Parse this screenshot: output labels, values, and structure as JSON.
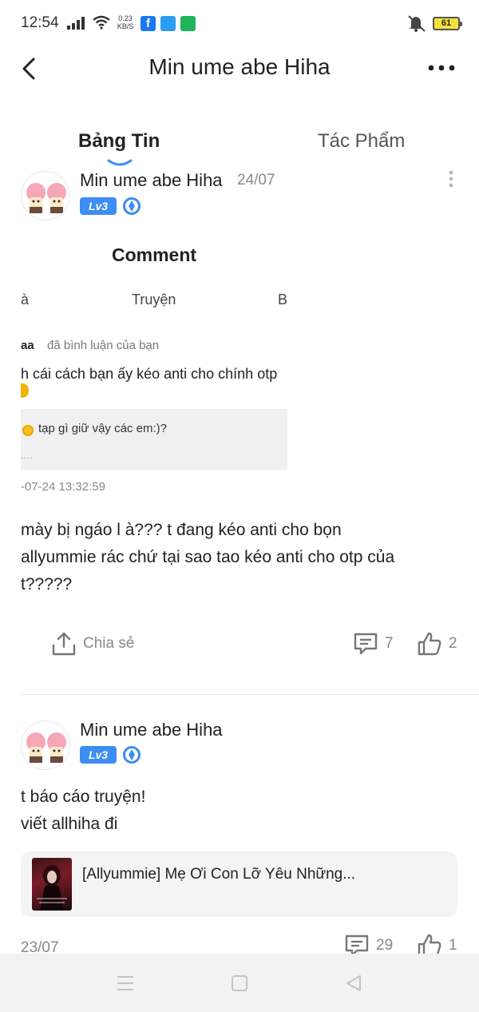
{
  "status_bar": {
    "time": "12:54",
    "net_speed_value": "0.23",
    "net_speed_unit": "KB/S",
    "battery": "61",
    "icons": [
      "signal-icon",
      "wifi-icon",
      "facebook-icon",
      "messenger-icon",
      "app-icon",
      "mute-icon",
      "battery-icon"
    ]
  },
  "header": {
    "title": "Min ume abe Hiha"
  },
  "tabs": [
    {
      "label": "Bảng Tin",
      "active": true
    },
    {
      "label": "Tác Phẩm",
      "active": false
    }
  ],
  "posts": [
    {
      "author": "Min ume abe Hiha",
      "date": "24/07",
      "level": "Lv3",
      "embedded": {
        "heading": "Comment",
        "tab_left": "à",
        "tab_mid": "Truyện",
        "tab_right": "B",
        "notif_user": "aa",
        "notif_action": "đã bình luận của bạn",
        "comment_text": "h cái cách bạn ấy kéo anti cho chính otp",
        "quote_text": "tạp gì giữ vậy các em:)?",
        "quote_more": "....",
        "timestamp": "-07-24 13:32:59"
      },
      "body_lines": [
        "mày bị ngáo l à??? t đang kéo anti cho bọn",
        "allyummie rác chứ tại sao tao kéo anti cho otp của",
        "t?????"
      ],
      "share_label": "Chia sẻ",
      "comments": "7",
      "likes": "2"
    },
    {
      "author": "Min ume abe Hiha",
      "level": "Lv3",
      "body_lines": [
        "t báo cáo truyện!",
        "viết allhiha đi"
      ],
      "story_title": "[Allyummie] Mẹ Ơi Con Lỡ Yêu Những...",
      "date": "23/07",
      "comments": "29",
      "likes": "1"
    }
  ],
  "colors": {
    "accent": "#3d8df3",
    "text": "#222222",
    "muted": "#888888"
  }
}
